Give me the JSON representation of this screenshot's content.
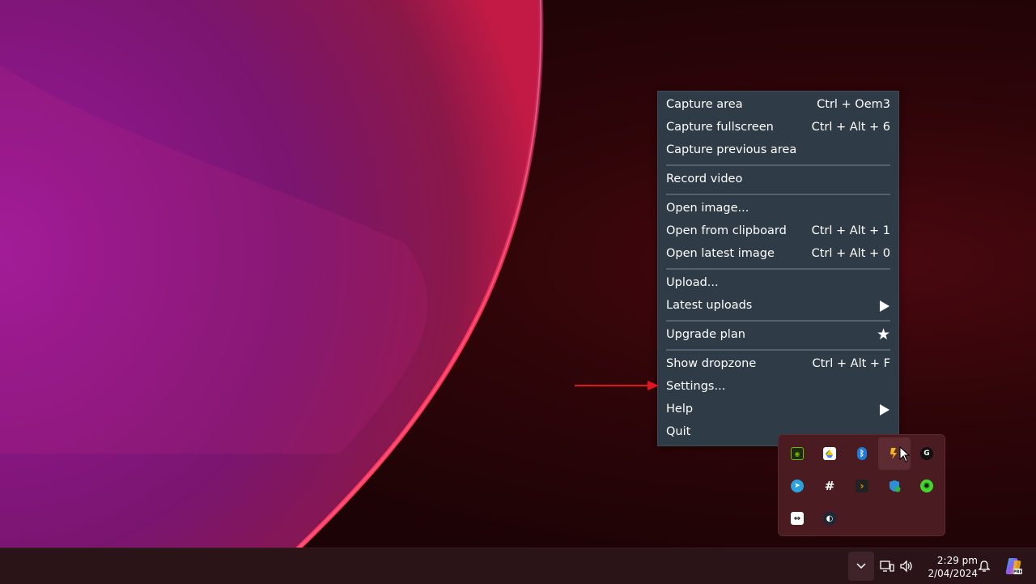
{
  "menu": {
    "items": [
      {
        "label": "Capture area",
        "shortcut": "Ctrl + Oem3"
      },
      {
        "label": "Capture fullscreen",
        "shortcut": "Ctrl + Alt + 6"
      },
      {
        "label": "Capture previous area",
        "shortcut": ""
      },
      {
        "label": "Record video",
        "shortcut": ""
      },
      {
        "label": "Open image...",
        "shortcut": ""
      },
      {
        "label": "Open from clipboard",
        "shortcut": "Ctrl + Alt + 1"
      },
      {
        "label": "Open latest image",
        "shortcut": "Ctrl + Alt + 0"
      },
      {
        "label": "Upload...",
        "shortcut": ""
      },
      {
        "label": "Latest uploads",
        "shortcut": "",
        "submenu": true
      },
      {
        "label": "Upgrade plan",
        "shortcut": "",
        "icon": "star-icon"
      },
      {
        "label": "Show dropzone",
        "shortcut": "Ctrl + Alt + F"
      },
      {
        "label": "Settings...",
        "shortcut": ""
      },
      {
        "label": "Help",
        "shortcut": "",
        "submenu": true
      },
      {
        "label": "Quit",
        "shortcut": ""
      }
    ]
  },
  "tray_flyout": {
    "icons": [
      "nvidia-icon",
      "google-drive-icon",
      "bluetooth-icon",
      "capture-app-icon",
      "logitech-icon",
      "telegram-icon",
      "slack-icon",
      "plex-icon",
      "defender-icon",
      "razer-icon",
      "teamviewer-icon",
      "steam-icon"
    ]
  },
  "taskbar": {
    "time": "2:29 pm",
    "date": "2/04/2024",
    "chevron": "⌄"
  },
  "colors": {
    "menu_bg": "#2f3b47",
    "accent_red": "#e0151f"
  }
}
